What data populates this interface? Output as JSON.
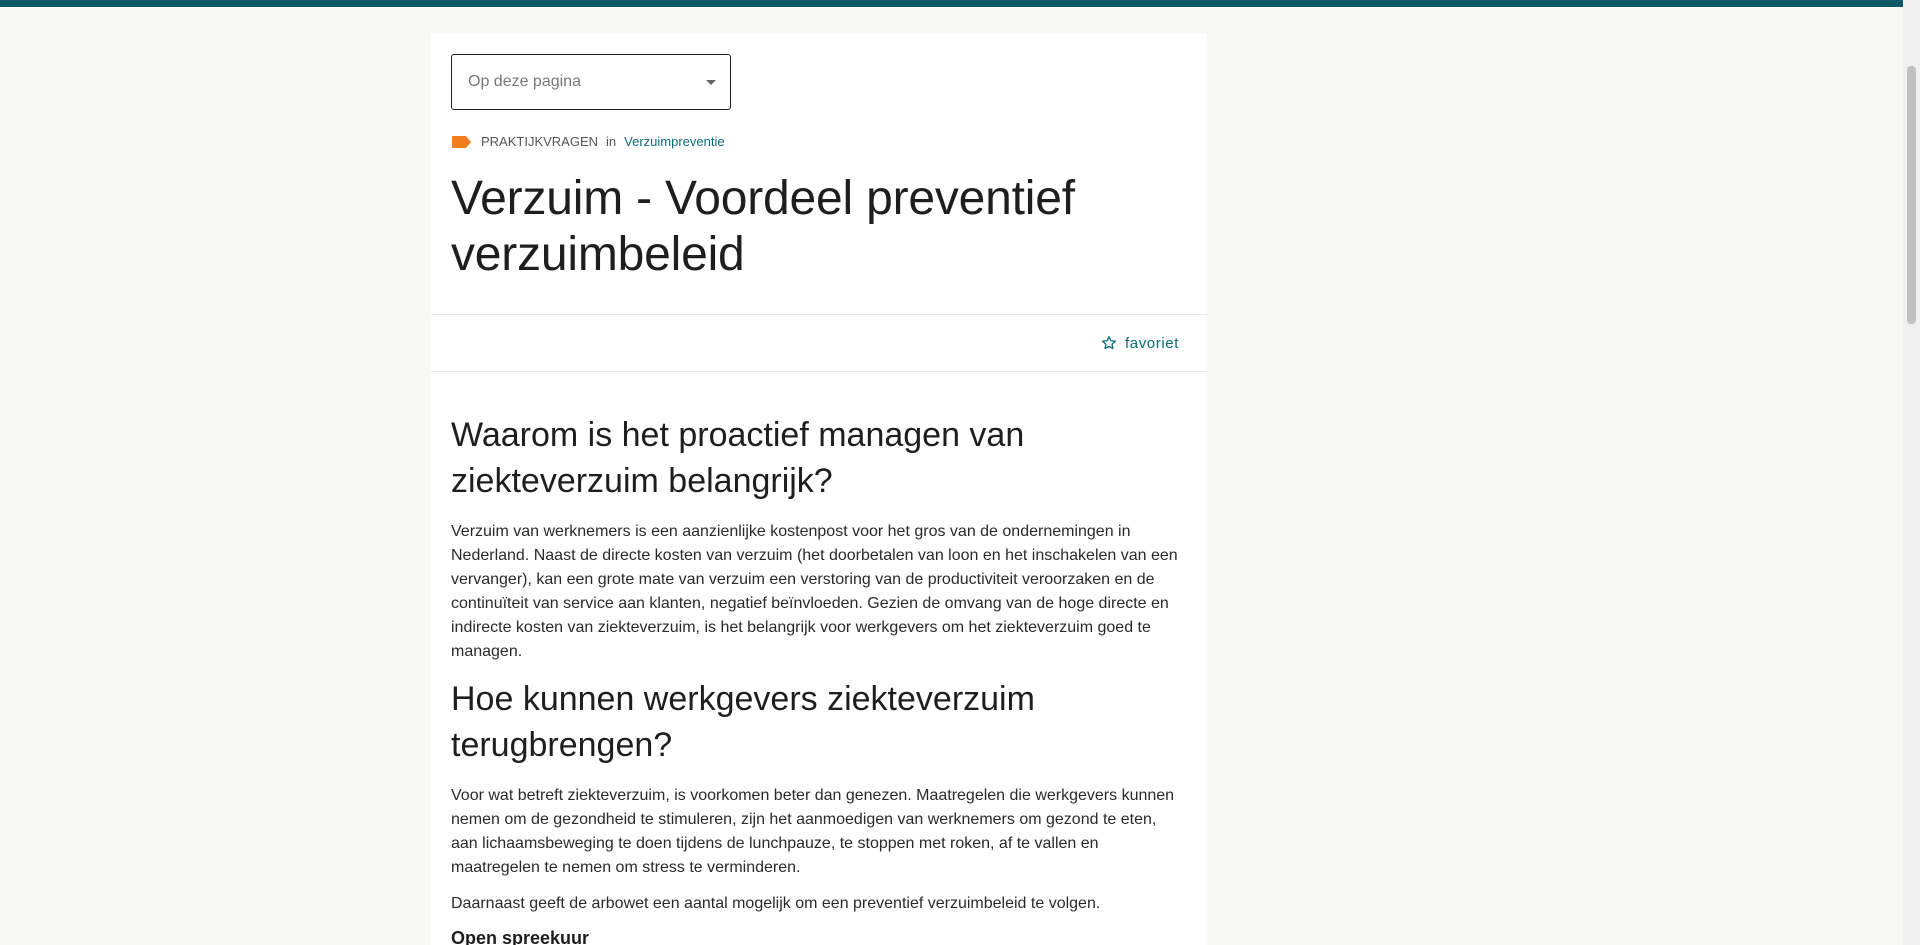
{
  "toc": {
    "label": "Op deze pagina"
  },
  "meta": {
    "category": "PRAKTIJKVRAGEN",
    "in": "in",
    "topic": "Verzuimpreventie"
  },
  "article": {
    "title": "Verzuim - Voordeel preventief verzuimbeleid",
    "favorite_label": "favoriet",
    "sections": [
      {
        "heading": "Waarom is het proactief managen van ziekteverzuim belangrijk?",
        "paragraphs": [
          "Verzuim van werknemers is een aanzienlijke kostenpost voor het gros van de ondernemingen in Nederland. Naast de directe kosten van verzuim (het doorbetalen van loon en het inschakelen van een vervanger), kan een grote mate van verzuim een verstoring van de productiviteit veroorzaken en de continuïteit van service aan klanten, negatief beïnvloeden. Gezien de omvang van de hoge directe en indirecte kosten van ziekteverzuim, is het belangrijk voor werkgevers om het ziekteverzuim goed te managen."
        ]
      },
      {
        "heading": "Hoe kunnen werkgevers ziekteverzuim terugbrengen?",
        "paragraphs": [
          "Voor wat betreft ziekteverzuim, is voorkomen beter dan genezen. Maatregelen die werkgevers kunnen nemen om de gezondheid te stimuleren, zijn het aanmoedigen van werknemers om gezond te eten, aan lichaamsbeweging te doen tijdens de lunchpauze, te stoppen met roken, af te vallen en maatregelen te nemen om stress te verminderen.",
          "Daarnaast geeft de arbowet een aantal mogelijk om een preventief verzuimbeleid te volgen."
        ]
      }
    ],
    "subheading": "Open spreekuur"
  },
  "colors": {
    "accent": "#0d6b77",
    "topbar": "#0d5a66",
    "tag": "#f07d1e"
  }
}
